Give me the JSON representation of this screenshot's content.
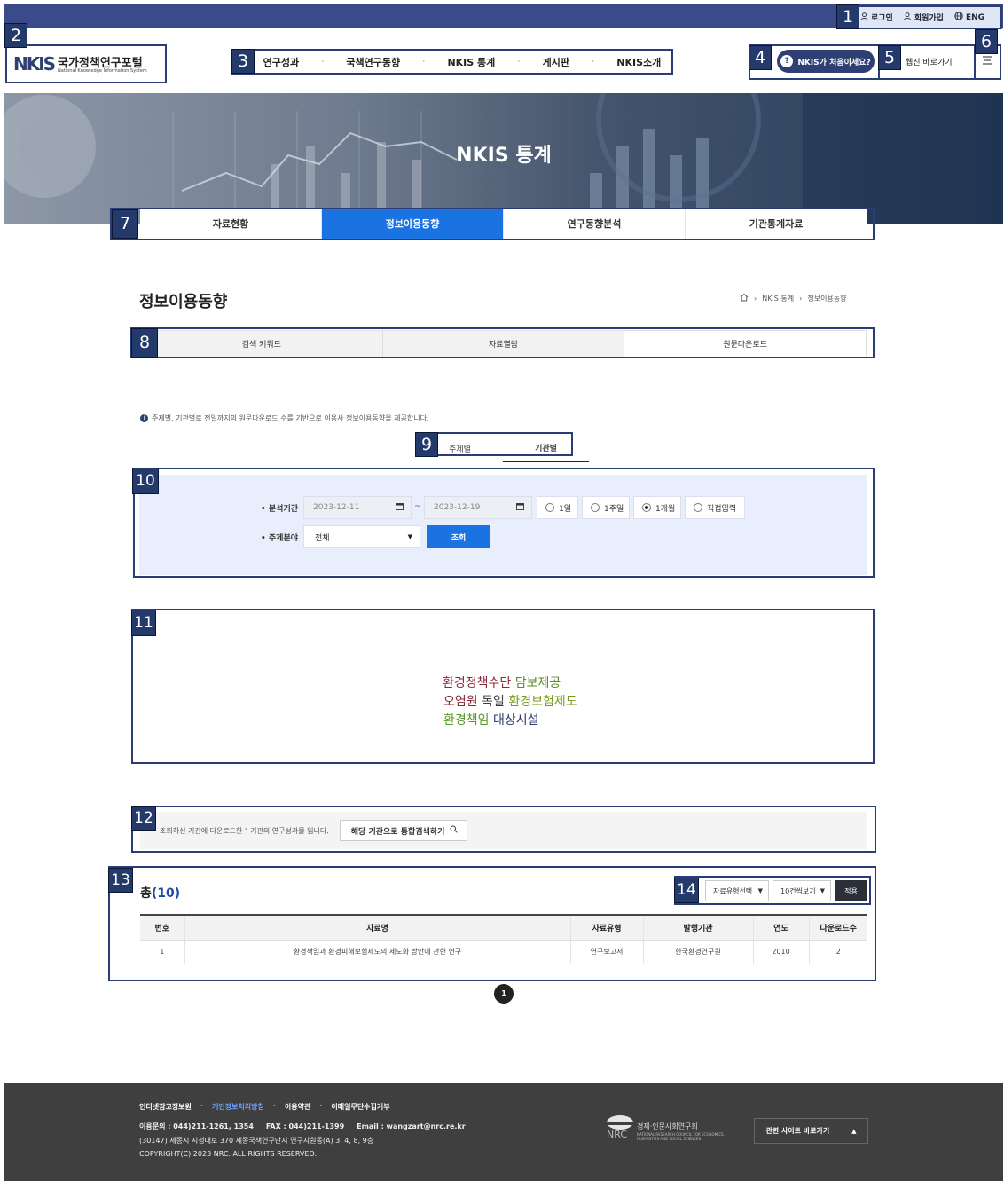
{
  "top_utility": {
    "login": "로그인",
    "signup": "회원가입",
    "lang": "ENG"
  },
  "logo": {
    "mark": "NKIS",
    "title": "국가정책연구포털",
    "subtitle": "National Knowledge Information System"
  },
  "gnb": [
    "연구성과",
    "국책연구동향",
    "NKIS 통계",
    "게시판",
    "NKIS소개"
  ],
  "header_actions": {
    "first_time": "NKIS가 처음이세요?",
    "webzine": "웹진 바로가기"
  },
  "hero": {
    "title": "NKIS 통계"
  },
  "main_tabs": [
    {
      "label": "자료현황",
      "active": false
    },
    {
      "label": "정보이용동향",
      "active": true
    },
    {
      "label": "연구동향분석",
      "active": false
    },
    {
      "label": "기관통계자료",
      "active": false
    }
  ],
  "page_title": "정보이용동향",
  "breadcrumb": {
    "level1": "NKIS 통계",
    "level2": "정보이용동향"
  },
  "sub_tabs": [
    {
      "label": "검색 키워드",
      "active": false
    },
    {
      "label": "자료열람",
      "active": false
    },
    {
      "label": "원문다운로드",
      "active": true
    }
  ],
  "notice": "주제별, 기관별로 전일까지의 원문다운로드 수를 기반으로 이용사 정보이용동향을 제공합니다.",
  "toggle_tabs": [
    {
      "label": "주제별",
      "active": false
    },
    {
      "label": "기관별",
      "active": true
    }
  ],
  "filter": {
    "period_label": "• 분석기간",
    "start_date": "2023-12-11",
    "tilde": "~",
    "end_date": "2023-12-19",
    "period_options": [
      {
        "label": "1일",
        "selected": false
      },
      {
        "label": "1주일",
        "selected": false
      },
      {
        "label": "1개월",
        "selected": true
      },
      {
        "label": "직접입력",
        "selected": false
      }
    ],
    "field_label": "• 주제분야",
    "field_value": "전체",
    "search_button": "조회"
  },
  "word_cloud": [
    [
      {
        "text": "환경정책수단",
        "color": "#8b2a3a"
      },
      {
        "text": "담보제공",
        "color": "#5a8a2a"
      }
    ],
    [
      {
        "text": "오염원",
        "color": "#8b2a3a"
      },
      {
        "text": "독일",
        "color": "#3a3a3a"
      },
      {
        "text": "환경보험제도",
        "color": "#7a9a1e"
      }
    ],
    [
      {
        "text": "환경책임",
        "color": "#5a9a2a"
      },
      {
        "text": "대상시설",
        "color": "#2a3a6a"
      }
    ]
  ],
  "org_notice": {
    "text": "조회하신 기간에 다운로드한 \" 기관의 연구성과물 입니다.",
    "button": "해당 기관으로 통합검색하기"
  },
  "results": {
    "total_label": "총",
    "total_count": "(10)",
    "type_select": "자료유형선택",
    "page_size_select": "10건씩보기",
    "apply_button": "적용",
    "columns": [
      "번호",
      "자료명",
      "자료유형",
      "발행기관",
      "연도",
      "다운로드수"
    ],
    "rows": [
      [
        "1",
        "환경책임과 환경피해보험제도의 제도화 방안에 관한 연구",
        "연구보고서",
        "한국환경연구원",
        "2010",
        "2"
      ]
    ]
  },
  "pagination": {
    "current": "1"
  },
  "footer": {
    "links": [
      {
        "label": "인터넷참고정보원",
        "highlight": false
      },
      {
        "label": "개인정보처리방침",
        "highlight": true
      },
      {
        "label": "이용약관",
        "highlight": false
      },
      {
        "label": "이메일무단수집거부",
        "highlight": false
      }
    ],
    "contact": "이용문의 : 044)211-1261, 1354     FAX : 044)211-1399     Email : wangzart@nrc.re.kr",
    "address": "(30147) 세종시 시청대로 370 세종국책연구단지 연구지원동(A) 3, 4, 8, 9층",
    "copyright": "COPYRIGHT(C) 2023 NRC. ALL RIGHTS RESERVED.",
    "nrc_name": "경제·인문사회연구회",
    "nrc_name_en": "NATIONAL RESEARCH COUNCIL FOR ECONOMICS, HUMANITIES AND SOCIAL SCIENCES",
    "related_sites": "관련 사이트 바로가기"
  },
  "annotation_badges": [
    "1",
    "2",
    "3",
    "4",
    "5",
    "6",
    "7",
    "8",
    "9",
    "10",
    "11",
    "12",
    "13",
    "14"
  ],
  "colors": {
    "primary_blue": "#1a73e0",
    "navy": "#2d3f73",
    "footer_bg": "#3f3f3f",
    "filter_bg": "#e8eefb"
  }
}
